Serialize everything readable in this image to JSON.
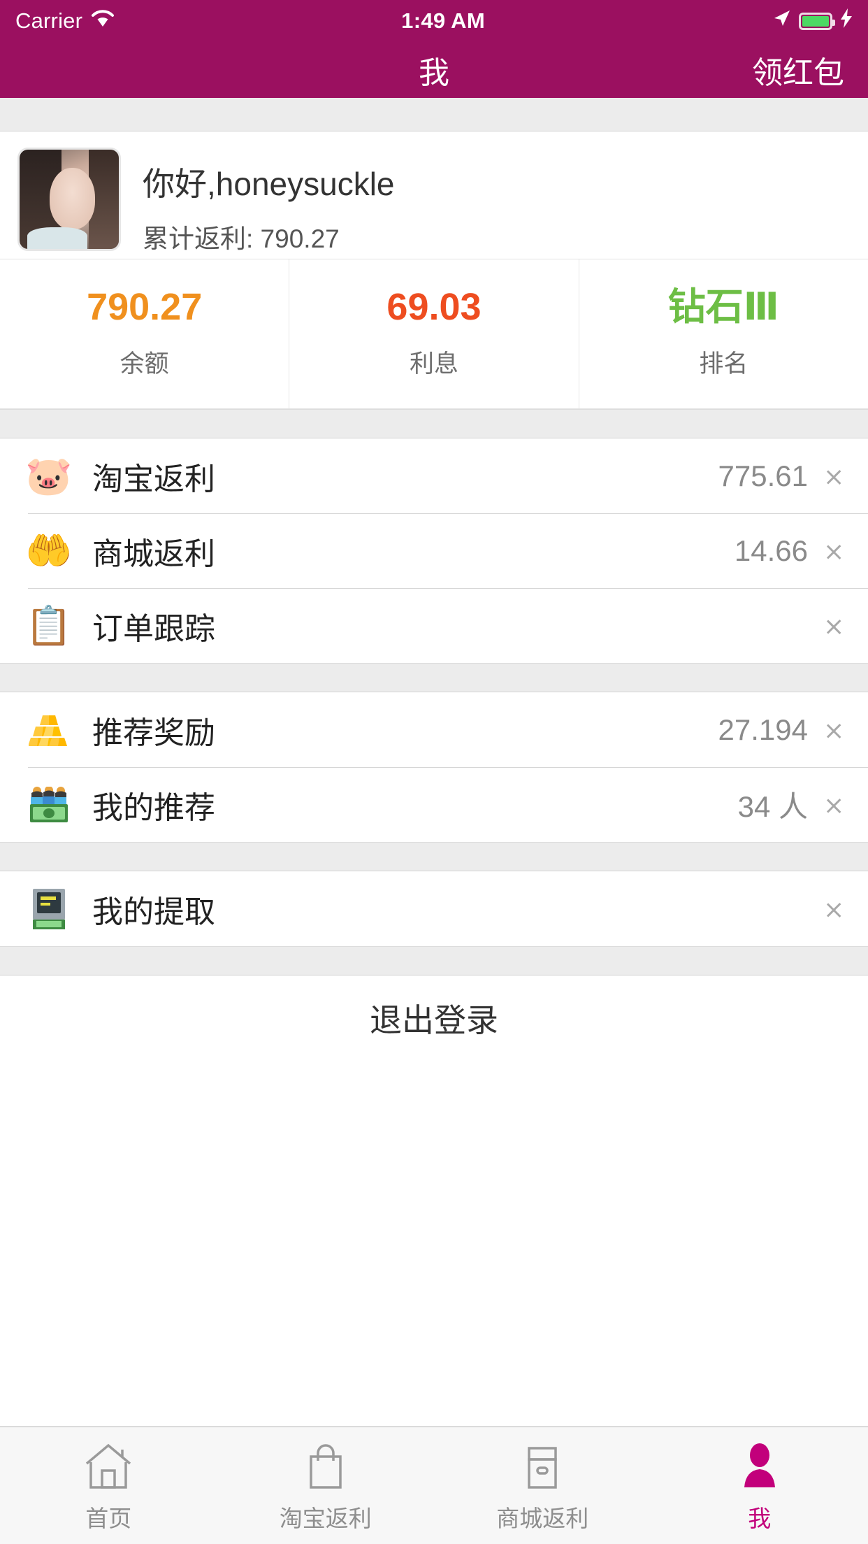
{
  "theme": {
    "header_bg": "#9B1060",
    "accent": "#C2007B",
    "page_bg": "#ececec"
  },
  "statusbar": {
    "carrier": "Carrier",
    "wifi_icon": "wifi-icon",
    "time": "1:49 AM",
    "location_icon": "location-arrow-icon",
    "battery_icon": "battery-icon",
    "charging_icon": "lightning-bolt-icon"
  },
  "navbar": {
    "title": "我",
    "right_action": "领红包"
  },
  "profile": {
    "avatar": "user-avatar-photo",
    "greeting": "你好,honeysuckle",
    "cumulative_label": "累计返利: 790.27"
  },
  "stats": [
    {
      "value": "790.27",
      "label": "余额",
      "color": "#F0901E"
    },
    {
      "value": "69.03",
      "label": "利息",
      "color": "#EE4D20"
    },
    {
      "value": "钻石Ⅲ",
      "label": "排名",
      "color": "#6DBE45"
    }
  ],
  "groups": [
    {
      "rows": [
        {
          "icon": "🐷",
          "icon_name": "piggy-bank-icon",
          "label": "淘宝返利",
          "value": "775.61"
        },
        {
          "icon": "🤲",
          "icon_name": "hand-with-coin-icon",
          "label": "商城返利",
          "value": "14.66"
        },
        {
          "icon": "📋",
          "icon_name": "clipboard-check-icon",
          "label": "订单跟踪",
          "value": ""
        }
      ]
    },
    {
      "rows": [
        {
          "icon": "🧱",
          "icon_name": "gold-bars-icon",
          "label": "推荐奖励",
          "value": "27.194"
        },
        {
          "icon": "👨‍👩‍👦",
          "icon_name": "people-money-icon",
          "label": "我的推荐",
          "value": "34 人"
        }
      ]
    },
    {
      "rows": [
        {
          "icon": "🏧",
          "icon_name": "atm-machine-icon",
          "label": "我的提取",
          "value": ""
        }
      ]
    }
  ],
  "logout": {
    "label": "退出登录"
  },
  "tabbar": [
    {
      "icon_name": "home-icon",
      "label": "首页",
      "active": false
    },
    {
      "icon_name": "shopping-bag-icon",
      "label": "淘宝返利",
      "active": false
    },
    {
      "icon_name": "store-box-icon",
      "label": "商城返利",
      "active": false
    },
    {
      "icon_name": "person-icon",
      "label": "我",
      "active": true
    }
  ]
}
